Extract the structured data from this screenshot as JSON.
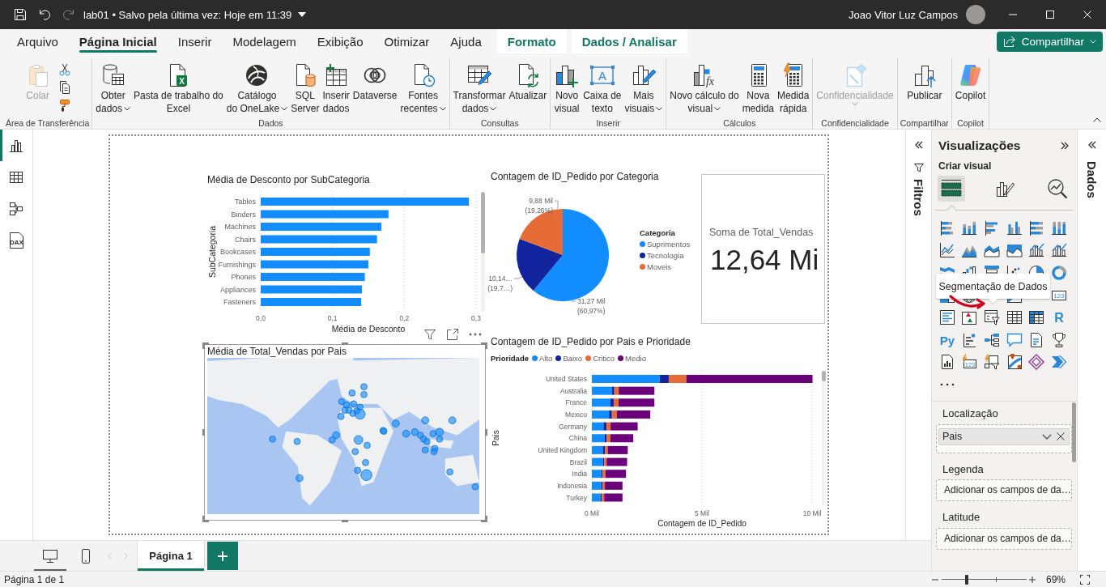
{
  "title_bar": {
    "document_title": "lab01 • Salvo pela última vez: Hoje em 11:39",
    "user_name": "Joao Vitor Luz Campos"
  },
  "ribbon_tabs": [
    {
      "label": "Arquivo",
      "kind": "standard",
      "selected": false
    },
    {
      "label": "Página Inicial",
      "kind": "standard",
      "selected": true
    },
    {
      "label": "Inserir",
      "kind": "standard",
      "selected": false
    },
    {
      "label": "Modelagem",
      "kind": "standard",
      "selected": false
    },
    {
      "label": "Exibição",
      "kind": "standard",
      "selected": false
    },
    {
      "label": "Otimizar",
      "kind": "standard",
      "selected": false
    },
    {
      "label": "Ajuda",
      "kind": "standard",
      "selected": false
    },
    {
      "label": "Formato",
      "kind": "contextual",
      "selected": false
    },
    {
      "label": "Dados / Analisar",
      "kind": "contextual",
      "selected": false
    }
  ],
  "share_button": {
    "label": "Compartilhar"
  },
  "ribbon_groups": [
    {
      "label": "Área de Transferência",
      "buttons": [
        {
          "kind": "paste",
          "lines": [
            "Colar"
          ],
          "dropdown": false,
          "disabled": true
        }
      ],
      "small_tools": [
        {
          "kind": "cut"
        },
        {
          "kind": "copy"
        },
        {
          "kind": "painter"
        }
      ]
    },
    {
      "label": "Dados",
      "buttons": [
        {
          "kind": "getdata",
          "lines": [
            "Obter",
            "dados"
          ],
          "dropdown": true,
          "disabled": false
        },
        {
          "kind": "excel",
          "glyph": "X",
          "lines": [
            "Pasta de trabalho do",
            "Excel"
          ],
          "dropdown": false,
          "disabled": false
        },
        {
          "kind": "onelake",
          "lines": [
            "Catálogo",
            "do OneLake"
          ],
          "dropdown": true,
          "disabled": false
        },
        {
          "kind": "sql",
          "lines": [
            "SQL",
            "Server"
          ],
          "dropdown": false,
          "disabled": false
        },
        {
          "kind": "enterdata",
          "lines": [
            "Inserir",
            "dados"
          ],
          "dropdown": false,
          "disabled": false
        },
        {
          "kind": "dataverse",
          "lines": [
            "Dataverse"
          ],
          "dropdown": false,
          "disabled": false
        },
        {
          "kind": "recent",
          "lines": [
            "Fontes",
            "recentes"
          ],
          "dropdown": true,
          "disabled": false
        }
      ]
    },
    {
      "label": "Consultas",
      "buttons": [
        {
          "kind": "transform",
          "lines": [
            "Transformar",
            "dados"
          ],
          "dropdown": true,
          "disabled": false
        },
        {
          "kind": "refresh",
          "lines": [
            "Atualizar"
          ],
          "dropdown": false,
          "disabled": false
        }
      ]
    },
    {
      "label": "Inserir",
      "buttons": [
        {
          "kind": "newvisual",
          "lines": [
            "Novo",
            "visual"
          ],
          "dropdown": false,
          "disabled": false
        },
        {
          "kind": "textbox",
          "glyph": "A",
          "lines": [
            "Caixa de",
            "texto"
          ],
          "dropdown": false,
          "disabled": false
        },
        {
          "kind": "morevisuals",
          "lines": [
            "Mais",
            "visuais"
          ],
          "dropdown": true,
          "disabled": false
        }
      ]
    },
    {
      "label": "Cálculos",
      "buttons": [
        {
          "kind": "visualcalc",
          "glyph": "fx",
          "lines": [
            "Novo cálculo do",
            "visual"
          ],
          "dropdown": true,
          "disabled": false
        },
        {
          "kind": "measure",
          "lines": [
            "Nova",
            "medida"
          ],
          "dropdown": false,
          "disabled": false
        },
        {
          "kind": "quickmeasure",
          "lines": [
            "Medida",
            "rápida"
          ],
          "dropdown": false,
          "disabled": false
        }
      ]
    },
    {
      "label": "Confidencialidade",
      "buttons": [
        {
          "kind": "sensitivity",
          "lines": [
            "Confidencialidade"
          ],
          "dropdown": true,
          "disabled": true
        }
      ]
    },
    {
      "label": "Compartilhar",
      "buttons": [
        {
          "kind": "publish",
          "lines": [
            "Publicar"
          ],
          "dropdown": false,
          "disabled": false
        }
      ]
    },
    {
      "label": "Copilot",
      "buttons": [
        {
          "kind": "copilot",
          "lines": [
            "Copilot"
          ],
          "dropdown": false,
          "disabled": false
        }
      ]
    }
  ],
  "view_rail": [
    {
      "kind": "report",
      "selected": true
    },
    {
      "kind": "table",
      "selected": false
    },
    {
      "kind": "model",
      "selected": false
    },
    {
      "kind": "dax",
      "glyph": "DAX",
      "selected": false
    }
  ],
  "report_page": {
    "visuals": [
      {
        "kind": "bar_chart",
        "chart_data": {
          "type": "bar",
          "orientation": "horizontal",
          "title": "Média de Desconto por SubCategoria",
          "xlabel": "Média de Desconto",
          "ylabel": "SubCategoria",
          "categories": [
            "Tables",
            "Binders",
            "Machines",
            "Chairs",
            "Bookcases",
            "Furnishings",
            "Phones",
            "Appliances",
            "Fasteners"
          ],
          "values": [
            0.29,
            0.178,
            0.168,
            0.162,
            0.152,
            0.15,
            0.145,
            0.141,
            0.14
          ],
          "xlim": [
            0,
            0.3
          ],
          "xticks": [
            {
              "value": 0,
              "label": "0,0"
            },
            {
              "value": 0.1,
              "label": "0,1"
            },
            {
              "value": 0.2,
              "label": "0,2"
            },
            {
              "value": 0.3,
              "label": "0,3"
            }
          ]
        }
      },
      {
        "kind": "pie_chart",
        "chart_data": {
          "type": "pie",
          "title": "Contagem de ID_Pedido por Categoria",
          "categories": [
            "Suprimentos",
            "Tecnologia",
            "Moveis"
          ],
          "values": [
            60.97,
            19.77,
            19.26
          ],
          "value_labels": [
            [
              "31,27 Mil",
              "(60,97%)"
            ],
            [
              "10,14…",
              "(19,7…)"
            ],
            [
              "9,88 Mil",
              "(19,26%)"
            ]
          ],
          "legend": {
            "title": "Categoria",
            "items": [
              {
                "color": "#118dff"
              },
              {
                "color": "#12239e"
              },
              {
                "color": "#e66c37"
              }
            ]
          }
        }
      },
      {
        "kind": "card",
        "label": "Soma de Total_Vendas",
        "value": "12,64 Mi"
      },
      {
        "kind": "map",
        "title": "Média de Total_Vendas por Pais",
        "selected": true
      },
      {
        "kind": "stacked_bar_chart",
        "chart_data": {
          "type": "bar",
          "orientation": "horizontal",
          "stacked": true,
          "title": "Contagem de ID_Pedido por Pais e Prioridade",
          "xlabel": "Contagem de ID_Pedido",
          "ylabel": "Pais",
          "categories": [
            "United States",
            "Australia",
            "France",
            "Mexico",
            "Germany",
            "China",
            "United Kingdom",
            "Brazil",
            "India",
            "Indonesia",
            "Turkey"
          ],
          "series": [
            {
              "name": "Alto",
              "color": "#118dff",
              "values": [
                3.08,
                0.91,
                0.84,
                0.78,
                0.53,
                0.58,
                0.5,
                0.5,
                0.43,
                0.43,
                0.39
              ]
            },
            {
              "name": "Baixo",
              "color": "#12239e",
              "values": [
                0.41,
                0.11,
                0.15,
                0.13,
                0.13,
                0.09,
                0.1,
                0.06,
                0.06,
                0.06,
                0.06
              ]
            },
            {
              "name": "Critico",
              "color": "#e66c37",
              "values": [
                0.8,
                0.2,
                0.22,
                0.22,
                0.19,
                0.17,
                0.12,
                0.11,
                0.13,
                0.1,
                0.11
              ]
            },
            {
              "name": "Medio",
              "color": "#6b007b",
              "values": [
                5.73,
                1.62,
                1.63,
                1.52,
                1.23,
                1.04,
                0.91,
                0.93,
                0.93,
                0.8,
                0.83
              ]
            }
          ],
          "xlim": [
            0,
            10
          ],
          "xticks": [
            {
              "value": 0,
              "label": "0 Mil"
            },
            {
              "value": 5,
              "label": "5 Mil"
            },
            {
              "value": 10,
              "label": "10 Mil"
            }
          ],
          "legend": {
            "title": "Prioridade"
          }
        }
      }
    ]
  },
  "filters_pane": {
    "label": "Filtros"
  },
  "visualizations_pane": {
    "title": "Visualizações",
    "section": "Criar visual",
    "modes": [
      {
        "kind": "build",
        "selected": true
      },
      {
        "kind": "format",
        "selected": false
      },
      {
        "kind": "analytics",
        "selected": false
      }
    ],
    "gallery": [
      {
        "kind": "stackedbar"
      },
      {
        "kind": "stackedcolumn"
      },
      {
        "kind": "clusteredbar"
      },
      {
        "kind": "clusteredcolumn"
      },
      {
        "kind": "fullbar"
      },
      {
        "kind": "fullcolumn"
      },
      {
        "kind": "line"
      },
      {
        "kind": "area"
      },
      {
        "kind": "stackedarea"
      },
      {
        "kind": "fullarea"
      },
      {
        "kind": "linecolumn"
      },
      {
        "kind": "linecolumn"
      },
      {
        "kind": "ribbon"
      },
      {
        "kind": "waterfall"
      },
      {
        "kind": "funnel"
      },
      {
        "kind": "scatter"
      },
      {
        "kind": "pie"
      },
      {
        "kind": "donut"
      },
      {
        "kind": "treemap"
      },
      {
        "kind": "globe"
      },
      {
        "kind": "covered"
      },
      {
        "kind": "azuremap"
      },
      {
        "kind": "covered"
      },
      {
        "kind": "card",
        "text": "123"
      },
      {
        "kind": "multicard"
      },
      {
        "kind": "kpi"
      },
      {
        "kind": "slicer"
      },
      {
        "kind": "table"
      },
      {
        "kind": "matrix"
      },
      {
        "kind": "glyph",
        "text": "R"
      },
      {
        "kind": "glyph",
        "text": "Py"
      },
      {
        "kind": "influencers"
      },
      {
        "kind": "decomposition"
      },
      {
        "kind": "qna"
      },
      {
        "kind": "narrative"
      },
      {
        "kind": "trophy"
      },
      {
        "kind": "paginated"
      },
      {
        "kind": "boltcard",
        "text": "123"
      },
      {
        "kind": "boltslicer"
      },
      {
        "kind": "routemap"
      },
      {
        "kind": "diamond"
      },
      {
        "kind": "chevrons"
      },
      {
        "kind": "more"
      }
    ],
    "tooltip": "Segmentação de Dados",
    "wells": [
      {
        "label": "Localização",
        "field": "Pais"
      },
      {
        "label": "Legenda",
        "placeholder": "Adicionar os campos de da…"
      },
      {
        "label": "Latitude",
        "placeholder": "Adicionar os campos de da…"
      }
    ]
  },
  "data_pane": {
    "label": "Dados"
  },
  "page_tabs": {
    "layouts": [
      {
        "kind": "desktop",
        "selected": true
      },
      {
        "kind": "mobile",
        "selected": false
      }
    ],
    "pages": [
      {
        "label": "Página 1",
        "selected": true
      }
    ]
  },
  "status_bar": {
    "page_info": "Página 1 de 1",
    "zoom": {
      "level": 0.3,
      "reading": "69%"
    }
  }
}
